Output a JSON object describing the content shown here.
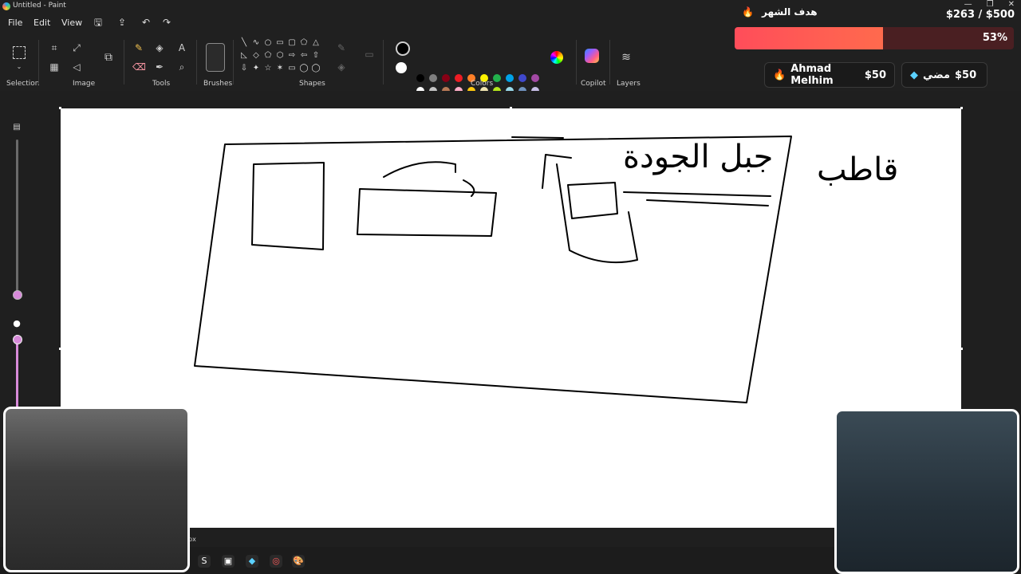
{
  "window": {
    "title": "Untitled - Paint",
    "controls": [
      "—",
      "❐",
      "✕"
    ]
  },
  "menu": {
    "file": "File",
    "edit": "Edit",
    "view": "View"
  },
  "ribbon": {
    "groups": {
      "selection": "Selection",
      "image": "Image",
      "tools": "Tools",
      "brushes": "Brushes",
      "shapes": "Shapes",
      "colors": "Colors",
      "copilot": "Copilot",
      "layers": "Layers"
    },
    "shape_glyphs": [
      "╲",
      "∿",
      "○",
      "▭",
      "▢",
      "⬠",
      "△",
      "◺",
      "◇",
      "⬠",
      "⬡",
      "⇨",
      "⇦",
      "⇧",
      "⇩",
      "✦",
      "☆",
      "✶",
      "▭",
      "◯",
      "◯",
      "⌒",
      "⌒"
    ],
    "palette_row1": [
      "#000000",
      "#7f7f7f",
      "#880015",
      "#ed1c24",
      "#ff7f27",
      "#fff200",
      "#22b14c",
      "#00a2e8",
      "#3f48cc",
      "#a349a4"
    ],
    "palette_row2": [
      "#ffffff",
      "#c3c3c3",
      "#b97a57",
      "#ffaec9",
      "#ffc90e",
      "#efe4b0",
      "#b5e61d",
      "#99d9ea",
      "#7092be",
      "#c8bfe7"
    ]
  },
  "canvas": {
    "arabic_label": "جبل الجودة",
    "arabic_label_2": "قاطب"
  },
  "status": {
    "unit": "px"
  },
  "overlay": {
    "goal_title": "هدف الشهر",
    "goal_amount": "$263 / $500",
    "goal_percent": "53%",
    "goal_progress": 0.53,
    "donor1": {
      "name": "Ahmad Melhim",
      "amount": "$50"
    },
    "donor2": {
      "name": "مضي",
      "amount": "$50"
    }
  },
  "colors": {
    "accent": "#d78ad9",
    "goal_fill": "#ff4d5a"
  }
}
